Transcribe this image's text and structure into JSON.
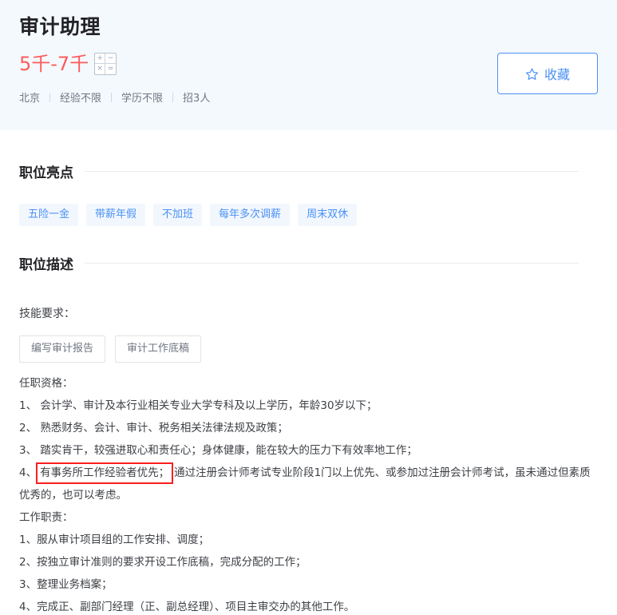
{
  "header": {
    "title": "审计助理",
    "salary": "5千-7千",
    "calculator_icon": {
      "keys": [
        "+",
        "−",
        "×",
        "="
      ]
    },
    "meta": [
      "北京",
      "经验不限",
      "学历不限",
      "招3人"
    ],
    "favorite_button": {
      "label": "收藏",
      "icon": "star-icon",
      "color": "#4a90f5"
    },
    "background_color": "#f4f9fd",
    "salary_color": "#fd5c5c"
  },
  "highlights": {
    "section_title": "职位亮点",
    "tags": [
      "五险一金",
      "带薪年假",
      "不加班",
      "每年多次调薪",
      "周末双休"
    ],
    "tag_color": "#4a90f5",
    "tag_background": "#f2f7fe"
  },
  "description": {
    "section_title": "职位描述",
    "skill_label": "技能要求：",
    "skills": [
      "编写审计报告",
      "审计工作底稿"
    ],
    "qualification_label": "任职资格：",
    "qualifications": [
      "1、 会计学、审计及本行业相关专业大学专科及以上学历，年龄30岁以下；",
      "2、 熟悉财务、会计、审计、税务相关法律法规及政策；",
      "3、 踏实肯干，较强进取心和责任心；身体健康，能在较大的压力下有效率地工作；"
    ],
    "item4": {
      "prefix": "4、",
      "highlighted": "有事务所工作经验者优先；",
      "rest": "通过注册会计师考试专业阶段1门以上优先、或参加过注册会计师考试，虽未通过但素质优秀的，也可以考虑。",
      "highlight_border_color": "#fa1e1e"
    },
    "duty_label": "工作职责：",
    "duties": [
      "1、服从审计项目组的工作安排、调度；",
      "2、按独立审计准则的要求开设工作底稿，完成分配的工作；",
      "3、整理业务档案；",
      "4、完成正、副部门经理（正、副总经理）、项目主审交办的其他工作。"
    ]
  }
}
